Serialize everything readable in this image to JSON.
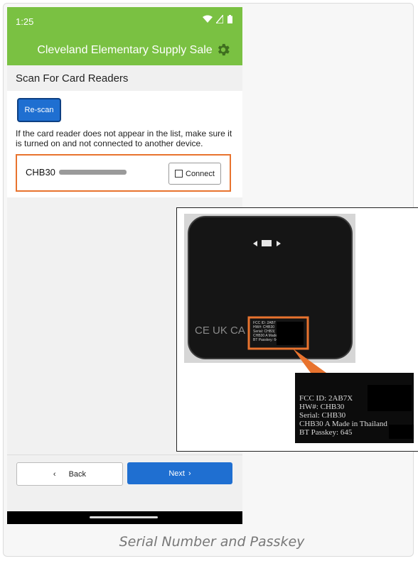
{
  "status_bar": {
    "time": "1:25",
    "icons": [
      "wifi-icon",
      "signal-icon",
      "battery-icon"
    ]
  },
  "app_bar": {
    "title": "Cleveland Elementary Supply Sale",
    "settings_icon": "gear-icon"
  },
  "section": {
    "title": "Scan For Card Readers"
  },
  "rescan_button": "Re-scan",
  "hint_text": "If the card reader does not appear in the list, make sure it is turned on and not connected to another device.",
  "reader": {
    "name": "CHB30",
    "connect_label": "Connect"
  },
  "footer": {
    "back_label": "Back",
    "next_label": "Next",
    "back_icon": "chevron-left-icon",
    "next_icon": "chevron-right-icon"
  },
  "device_label": {
    "fcc_id": "FCC ID: 2AB7X",
    "hw": "HW#: CHB30",
    "serial": "Serial: CHB30",
    "model_line": "CHB30 A Made in Thailand",
    "passkey": "BT Passkey: 645",
    "small_fcc": "FCC ID: 2AB7",
    "small_hw": "HW#: CHB30",
    "small_serial": "Serial: CHB3(",
    "small_model": "CHB30 A Made in Thailand",
    "small_passkey": "BT Passkey: 645",
    "logos": "CE UK CA"
  },
  "colors": {
    "brand_green": "#7ac142",
    "primary_blue": "#1f6fd1",
    "highlight_orange": "#e8732e"
  },
  "caption": "Serial Number and Passkey"
}
